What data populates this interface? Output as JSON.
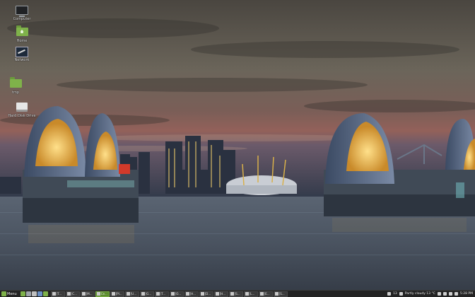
{
  "desktop": {
    "icons": [
      {
        "label": "Computer",
        "icon": "computer-icon"
      },
      {
        "label": "Home",
        "icon": "home-folder-icon"
      },
      {
        "label": "Network",
        "icon": "network-icon"
      },
      {
        "label": "tmp",
        "icon": "folder-icon"
      },
      {
        "label": "Hard Disk Drive",
        "icon": "drive-icon"
      }
    ]
  },
  "taskbar": {
    "menu_label": "Menu",
    "tasks": [
      {
        "label": "[T..."
      },
      {
        "label": "[C..."
      },
      {
        "label": "[M..."
      },
      {
        "label": "Ce..."
      },
      {
        "label": "[Pl..."
      },
      {
        "label": "[U..."
      },
      {
        "label": "[G..."
      },
      {
        "label": "[T..."
      },
      {
        "label": "[O..."
      },
      {
        "label": "[H..."
      },
      {
        "label": "[D..."
      },
      {
        "label": "[H..."
      },
      {
        "label": "[S..."
      },
      {
        "label": "[L..."
      },
      {
        "label": "[E..."
      },
      {
        "label": "[S..."
      }
    ],
    "active_task_index": 3,
    "tray": {
      "count": "13",
      "weather": "Partly cloudy 13 °C",
      "time": "5:28 PM"
    }
  },
  "colors": {
    "taskbar_bg": "#232323",
    "accent": "#7fb24a"
  }
}
